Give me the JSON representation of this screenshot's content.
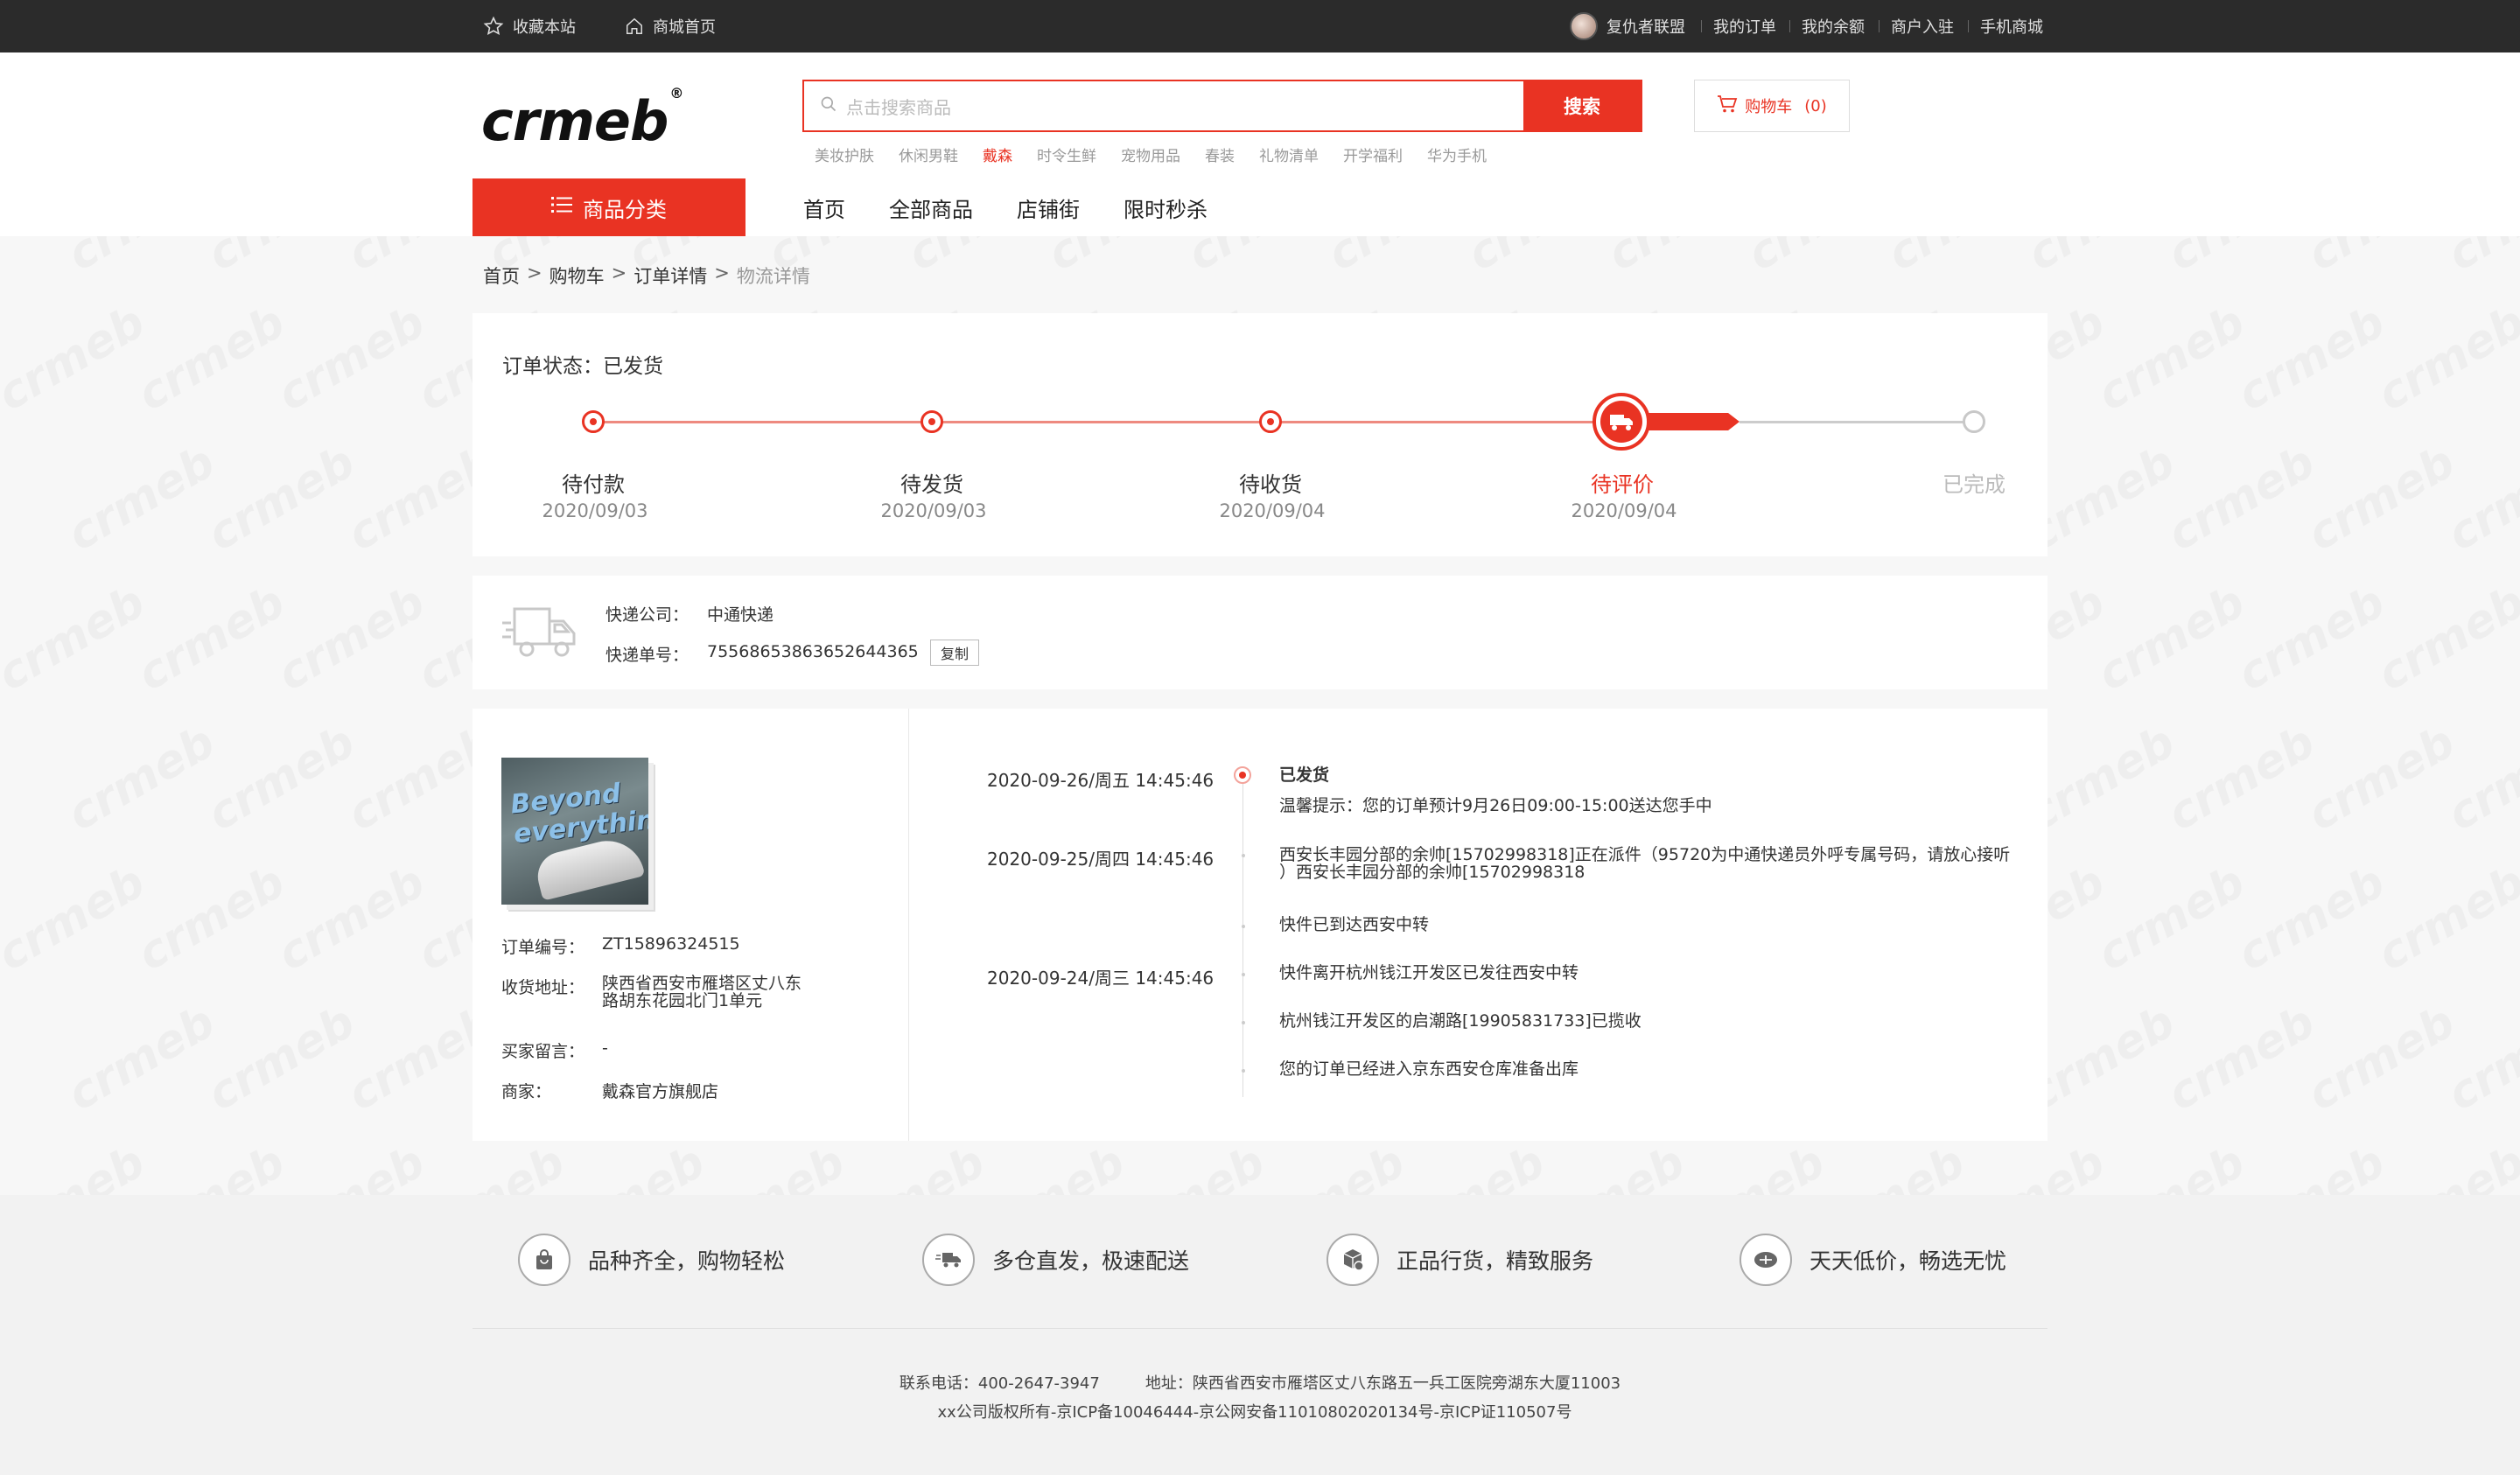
{
  "topbar": {
    "favorite": "收藏本站",
    "mall_home": "商城首页",
    "username": "复仇者联盟",
    "my_orders": "我的订单",
    "my_balance": "我的余额",
    "merchant_join": "商户入驻",
    "mobile_mall": "手机商城"
  },
  "header": {
    "logo": "crmeb",
    "logo_mark": "®",
    "search_placeholder": "点击搜索商品",
    "search_button": "搜索",
    "hotwords": [
      "美妆护肤",
      "休闲男鞋",
      "戴森",
      "时令生鲜",
      "宠物用品",
      "春装",
      "礼物清单",
      "开学福利",
      "华为手机"
    ],
    "hot_index": 2,
    "cart_label": "购物车",
    "cart_count": "(0)",
    "category_button": "商品分类",
    "nav": [
      "首页",
      "全部商品",
      "店铺街",
      "限时秒杀"
    ]
  },
  "breadcrumb": {
    "items": [
      "首页",
      "购物车",
      "订单详情"
    ],
    "current": "物流详情",
    "separator": ">"
  },
  "order_status": {
    "label": "订单状态：",
    "value": "已发货",
    "steps": [
      {
        "name": "待付款",
        "date": "2020/09/03"
      },
      {
        "name": "待发货",
        "date": "2020/09/03"
      },
      {
        "name": "待收货",
        "date": "2020/09/04"
      },
      {
        "name": "待评价",
        "date": "2020/09/04"
      },
      {
        "name": "已完成",
        "date": ""
      }
    ]
  },
  "express": {
    "company_label": "快递公司：",
    "company": "中通快递",
    "number_label": "快递单号：",
    "number": "75568653863652644365",
    "copy": "复制"
  },
  "order": {
    "product_text_1": "Beyond",
    "product_text_2": "everything",
    "number_label": "订单编号：",
    "number": "ZT15896324515",
    "address_label": "收货地址：",
    "address_line1": "陕西省西安市雁塔区丈八东",
    "address_line2": "路胡东花园北门1单元",
    "note_label": "买家留言：",
    "note": "-",
    "merchant_label": "商家：",
    "merchant": "戴森官方旗舰店"
  },
  "timeline": [
    {
      "time": "2020-09-26/周五 14:45:46",
      "title": "已发货",
      "text": "温馨提示：您的订单预计9月26日09:00-15:00送达您手中"
    },
    {
      "time": "2020-09-25/周四 14:45:46",
      "text1": "西安长丰园分部的余帅[15702998318]正在派件（95720为中通快递员外呼专属号码，请放心接听",
      "text2": "）西安长丰园分部的余帅[15702998318"
    },
    {
      "time": "",
      "text": "快件已到达西安中转"
    },
    {
      "time": "2020-09-24/周三 14:45:46",
      "text": "快件离开杭州钱江开发区已发往西安中转"
    },
    {
      "time": "",
      "text": "杭州钱江开发区的启潮路[19905831733]已揽收"
    },
    {
      "time": "",
      "text": "您的订单已经进入京东西安仓库准备出库"
    }
  ],
  "footer": {
    "features": [
      "品种齐全，购物轻松",
      "多仓直发，极速配送",
      "正品行货，精致服务",
      "天天低价，畅选无忧"
    ],
    "contact": "联系电话：400-2647-3947",
    "address": "地址：陕西省西安市雁塔区丈八东路五一兵工医院旁湖东大厦11003",
    "copyright": "xx公司版权所有-京ICP备10046444-京公网安备11010802020134号-京ICP证110507号"
  },
  "colors": {
    "accent": "#e93323",
    "topbar": "#2b2b2b"
  }
}
